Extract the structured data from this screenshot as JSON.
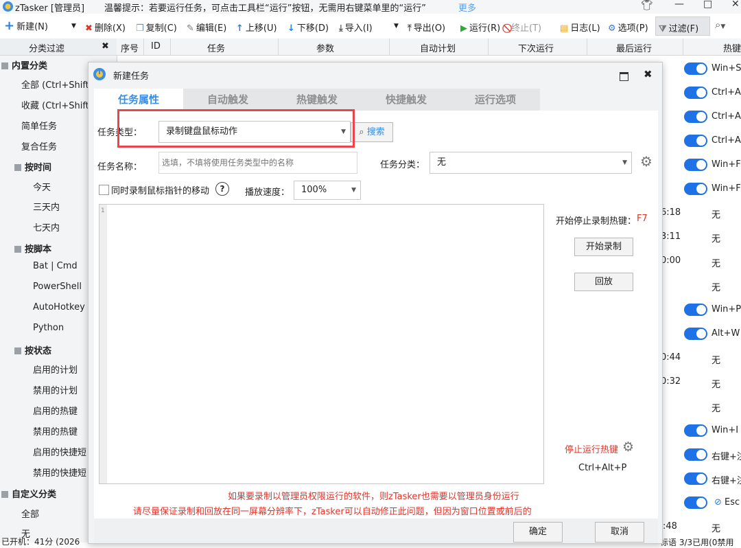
{
  "app": {
    "title": "zTasker [管理员]",
    "tip": "温馨提示：若要运行任务，可点击工具栏“运行”按钮，无需用右键菜单里的“运行”",
    "more": "更多"
  },
  "toolbar": {
    "new": "新建(N)",
    "delete": "删除(X)",
    "copy": "复制(C)",
    "edit": "编辑(E)",
    "up": "上移(U)",
    "down": "下移(D)",
    "import": "导入(I)",
    "export": "导出(O)",
    "run": "运行(R)",
    "stop": "终止(T)",
    "log": "日志(L)",
    "options": "选项(P)",
    "filter": "过滤(F)"
  },
  "left_header": "分类过滤",
  "columns": [
    "序号",
    "ID",
    "任务",
    "参数",
    "自动计划",
    "下次运行",
    "最后运行",
    "热键"
  ],
  "sidebar": {
    "builtin": "内置分类",
    "all": "全部 (Ctrl+Shift",
    "fav": "收藏 (Ctrl+Shift",
    "simple": "简单任务",
    "complex": "复合任务",
    "by_time": "按时间",
    "today": "今天",
    "three_days": "三天内",
    "seven_days": "七天内",
    "by_script": "按脚本",
    "bat": "Bat | Cmd",
    "ps": "PowerShell",
    "ahk": "AutoHotkey",
    "py": "Python",
    "by_status": "按状态",
    "en_plan": "启用的计划",
    "dis_plan": "禁用的计划",
    "en_hot": "启用的热键",
    "dis_hot": "禁用的热键",
    "en_short": "启用的快捷短",
    "dis_short": "禁用的快捷短",
    "custom": "自定义分类",
    "custom_all": "全部",
    "custom_none": "无"
  },
  "right_col": {
    "r0": "Win+S",
    "r1": "Ctrl+A",
    "r2": "Ctrl+A",
    "r3": "Ctrl+A",
    "r4": "Win+F",
    "r5": "Win+F",
    "t6": "6:18",
    "n6": "无",
    "t7": "3:11",
    "n7": "无",
    "t8": "0:00",
    "n8": "无",
    "n9": "无",
    "r10": "Win+P",
    "r11": "Alt+W",
    "t12": "0:44",
    "n12": "无",
    "t13": "0:32",
    "n13": "无",
    "n14": "无",
    "r15": "Win+I",
    "r16": "右键+注",
    "r17": "右键+注",
    "r18": "Esc",
    "t19": ":48",
    "n19": "无"
  },
  "status_bar": {
    "left": "已开机：41分 (2026",
    "right": "标语 3/3已用(0禁用"
  },
  "dialog": {
    "title": "新建任务",
    "tabs": [
      "任务属性",
      "自动触发",
      "热键触发",
      "快捷触发",
      "运行选项"
    ],
    "task_type_label": "任务类型：",
    "task_type_value": "录制键盘鼠标动作",
    "search": "搜索",
    "task_name_label": "任务名称：",
    "task_name_placeholder": "选填，不填将使用任务类型中的名称",
    "category_label": "任务分类：",
    "category_value": "无",
    "record_mouse": "同时录制鼠标指针的移动",
    "speed_label": "播放速度：",
    "speed_value": "100%",
    "line_no": "1",
    "hotkey_label": "开始停止录制热键：",
    "hotkey_value": "F7",
    "start_record": "开始录制",
    "playback": "回放",
    "stop_hotkey_label": "停止运行热键",
    "stop_hotkey_value": "Ctrl+Alt+P",
    "note1": "如果要录制以管理员权限运行的软件，则zTasker也需要以管理员身份运行",
    "note2": "请尽量保证录制和回放在同一屏幕分辨率下，zTasker可以自动修正此问题，但因为窗口位置或前后的",
    "ok": "确定",
    "cancel": "取消"
  },
  "colors": {
    "accent": "#3a8ee6",
    "toggle": "#1e72e6",
    "highlight": "#e8454d",
    "warn": "#e0332a"
  }
}
